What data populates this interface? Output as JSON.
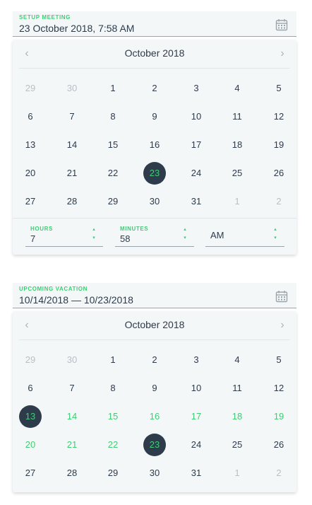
{
  "meeting": {
    "label": "SETUP MEETING",
    "value": "23 October 2018, 7:58 AM",
    "calendar": {
      "month_title": "October 2018",
      "prev_icon": "chevron-left-icon",
      "next_icon": "chevron-right-icon",
      "weeks": [
        [
          {
            "d": "29",
            "muted": true
          },
          {
            "d": "30",
            "muted": true
          },
          {
            "d": "1"
          },
          {
            "d": "2"
          },
          {
            "d": "3"
          },
          {
            "d": "4"
          },
          {
            "d": "5"
          }
        ],
        [
          {
            "d": "6"
          },
          {
            "d": "7"
          },
          {
            "d": "8"
          },
          {
            "d": "9"
          },
          {
            "d": "10"
          },
          {
            "d": "11"
          },
          {
            "d": "12"
          }
        ],
        [
          {
            "d": "13"
          },
          {
            "d": "14"
          },
          {
            "d": "15"
          },
          {
            "d": "16"
          },
          {
            "d": "17"
          },
          {
            "d": "18"
          },
          {
            "d": "19"
          }
        ],
        [
          {
            "d": "20"
          },
          {
            "d": "21"
          },
          {
            "d": "22"
          },
          {
            "d": "23",
            "selected": true
          },
          {
            "d": "24"
          },
          {
            "d": "25"
          },
          {
            "d": "26"
          }
        ],
        [
          {
            "d": "27"
          },
          {
            "d": "28"
          },
          {
            "d": "29"
          },
          {
            "d": "30"
          },
          {
            "d": "31"
          },
          {
            "d": "1",
            "muted": true
          },
          {
            "d": "2",
            "muted": true
          }
        ]
      ]
    },
    "time": {
      "hours_label": "HOURS",
      "hours_value": "7",
      "minutes_label": "MINUTES",
      "minutes_value": "58",
      "ampm_value": "AM"
    }
  },
  "vacation": {
    "label": "UPCOMING VACATION",
    "value": "10/14/2018 — 10/23/2018",
    "calendar": {
      "month_title": "October 2018",
      "weeks": [
        [
          {
            "d": "29",
            "muted": true
          },
          {
            "d": "30",
            "muted": true
          },
          {
            "d": "1"
          },
          {
            "d": "2"
          },
          {
            "d": "3"
          },
          {
            "d": "4"
          },
          {
            "d": "5"
          }
        ],
        [
          {
            "d": "6"
          },
          {
            "d": "7"
          },
          {
            "d": "8"
          },
          {
            "d": "9"
          },
          {
            "d": "10"
          },
          {
            "d": "11"
          },
          {
            "d": "12"
          }
        ],
        [
          {
            "d": "13",
            "selected": true
          },
          {
            "d": "14",
            "range": true
          },
          {
            "d": "15",
            "range": true
          },
          {
            "d": "16",
            "range": true
          },
          {
            "d": "17",
            "range": true
          },
          {
            "d": "18",
            "range": true
          },
          {
            "d": "19",
            "range": true
          }
        ],
        [
          {
            "d": "20",
            "range": true
          },
          {
            "d": "21",
            "range": true
          },
          {
            "d": "22",
            "range": true
          },
          {
            "d": "23",
            "selected": true
          },
          {
            "d": "24"
          },
          {
            "d": "25"
          },
          {
            "d": "26"
          }
        ],
        [
          {
            "d": "27"
          },
          {
            "d": "28"
          },
          {
            "d": "29"
          },
          {
            "d": "30"
          },
          {
            "d": "31"
          },
          {
            "d": "1",
            "muted": true
          },
          {
            "d": "2",
            "muted": true
          }
        ]
      ]
    }
  },
  "colors": {
    "accent": "#3dce74",
    "dark": "#2d3b4b",
    "muted": "#b8c0c7",
    "panel": "#f4f7f8"
  }
}
